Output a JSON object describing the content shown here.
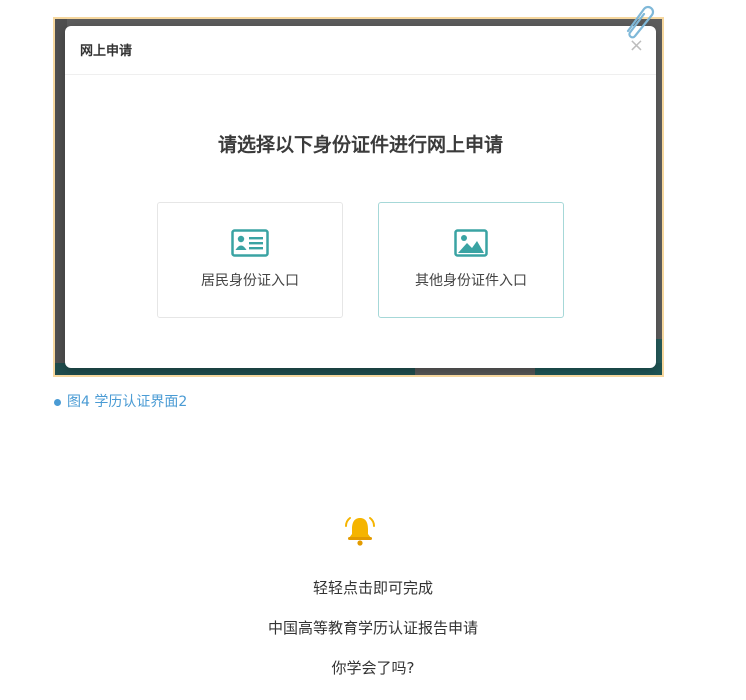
{
  "dialog": {
    "title": "网上申请",
    "close_symbol": "×",
    "heading": "请选择以下身份证件进行网上申请",
    "options": [
      {
        "label": "居民身份证入口",
        "icon": "id-card-icon"
      },
      {
        "label": "其他身份证件入口",
        "icon": "image-icon"
      }
    ]
  },
  "caption": {
    "text": "图4 学历认证界面2"
  },
  "footer": {
    "lines": [
      "轻轻点击即可完成",
      "中国高等教育学历认证报告申请",
      "你学会了吗?"
    ]
  },
  "colors": {
    "teal_icon": "#3aa3a3",
    "caption_blue": "#4a9bd4",
    "frame_border": "#f6d79e",
    "bell_yellow": "#f5b400"
  }
}
